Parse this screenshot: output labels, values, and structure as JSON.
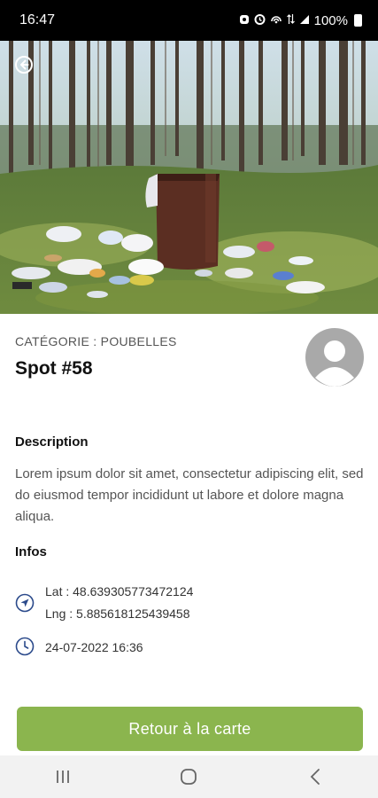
{
  "status_bar": {
    "time": "16:47",
    "battery": "100%"
  },
  "spot": {
    "category": "CATÉGORIE : POUBELLES",
    "title": "Spot #58",
    "description_label": "Description",
    "description": "Lorem ipsum dolor sit amet, consectetur adipiscing elit, sed do eiusmod tempor incididunt ut labore et dolore magna aliqua.",
    "infos_label": "Infos",
    "lat": "Lat : 48.639305773472124",
    "lng": "Lng : 5.885618125439458",
    "datetime": "24-07-2022 16:36"
  },
  "actions": {
    "back_to_map": "Retour à la carte"
  },
  "icons": {
    "back": "back-arrow-icon",
    "location": "navigation-arrow-icon",
    "clock": "clock-icon",
    "avatar": "user-avatar-icon"
  },
  "colors": {
    "accent": "#8bb54e",
    "icon_blue": "#2b4a8b"
  }
}
